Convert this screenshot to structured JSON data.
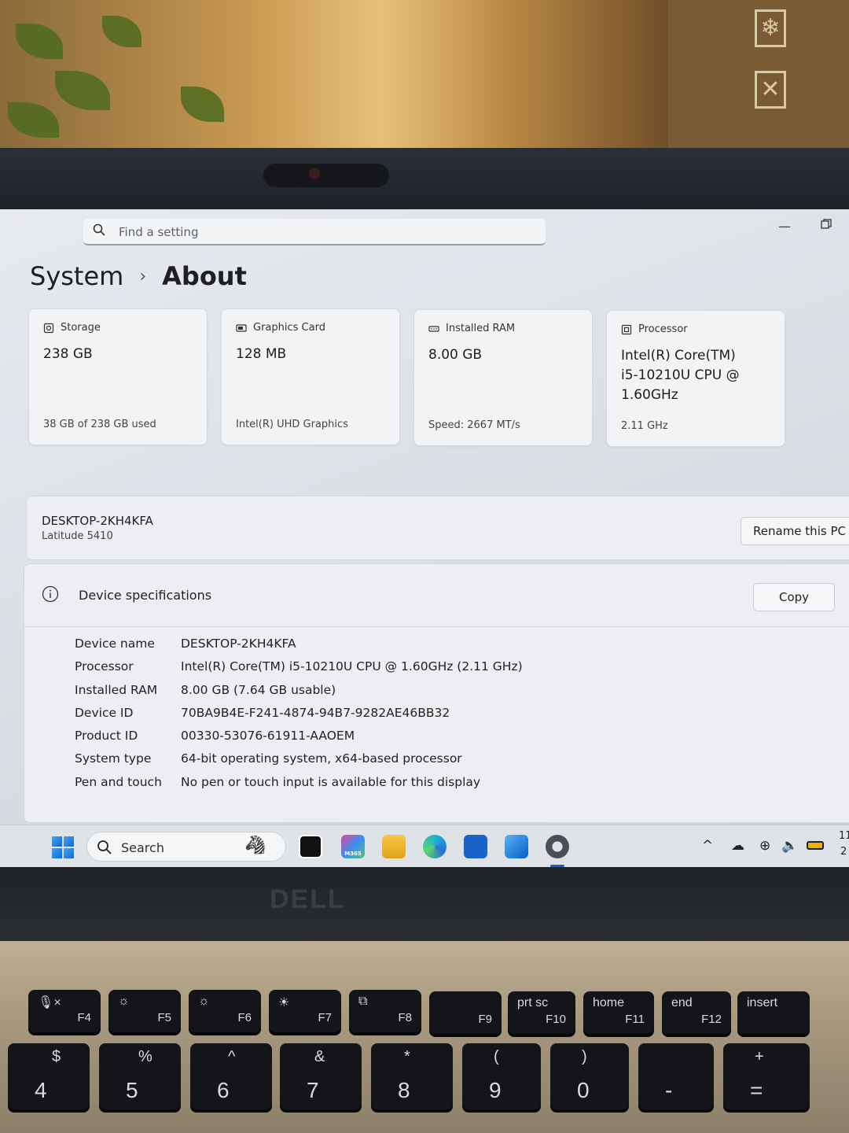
{
  "search": {
    "placeholder": "Find a setting"
  },
  "breadcrumb": {
    "parent": "System",
    "separator": "›",
    "current": "About"
  },
  "cards": [
    {
      "icon": "storage-icon",
      "title": "Storage",
      "value": "238 GB",
      "sub": "38 GB of 238 GB used"
    },
    {
      "icon": "graphics-card-icon",
      "title": "Graphics Card",
      "value": "128 MB",
      "sub": "Intel(R) UHD Graphics"
    },
    {
      "icon": "ram-icon",
      "title": "Installed RAM",
      "value": "8.00 GB",
      "sub": "Speed: 2667 MT/s"
    },
    {
      "icon": "processor-icon",
      "title": "Processor",
      "value": "Intel(R) Core(TM) i5-10210U CPU @ 1.60GHz",
      "sub": "2.11 GHz"
    }
  ],
  "pc": {
    "name": "DESKTOP-2KH4KFA",
    "model": "Latitude 5410",
    "rename_label": "Rename this PC"
  },
  "specs": {
    "title": "Device specifications",
    "copy_label": "Copy",
    "rows": [
      {
        "label": "Device name",
        "value": "DESKTOP-2KH4KFA"
      },
      {
        "label": "Processor",
        "value": "Intel(R) Core(TM) i5-10210U CPU @ 1.60GHz (2.11 GHz)"
      },
      {
        "label": "Installed RAM",
        "value": "8.00 GB (7.64 GB usable)"
      },
      {
        "label": "Device ID",
        "value": "70BA9B4E-F241-4874-94B7-9282AE46BB32"
      },
      {
        "label": "Product ID",
        "value": "00330-53076-61911-AAOEM"
      },
      {
        "label": "System type",
        "value": "64-bit operating system, x64-based processor"
      },
      {
        "label": "Pen and touch",
        "value": "No pen or touch input is available for this display"
      }
    ]
  },
  "taskbar": {
    "search_label": "Search",
    "apps": [
      "task-view-icon",
      "m365-icon",
      "file-explorer-icon",
      "edge-icon",
      "store-icon",
      "outlook-icon",
      "settings-icon"
    ],
    "m365_badge": "M365",
    "clock_partial": "11",
    "clock_partial2": "2"
  },
  "hardware": {
    "brand": "DELL",
    "keys_fn": [
      {
        "top": "🎙×",
        "bot": "F4"
      },
      {
        "top": "☼",
        "bot": "F5"
      },
      {
        "top": "☼",
        "bot": "F6"
      },
      {
        "top": "☀",
        "bot": "F7"
      },
      {
        "top": "⧉",
        "bot": "F8"
      },
      {
        "top": "",
        "bot": "F9"
      },
      {
        "top": "prt sc",
        "bot": "F10"
      },
      {
        "top": "home",
        "bot": "F11"
      },
      {
        "top": "end",
        "bot": "F12"
      },
      {
        "top": "insert",
        "bot": ""
      }
    ],
    "keys_num": [
      {
        "top": "$",
        "big": "4"
      },
      {
        "top": "%",
        "big": "5"
      },
      {
        "top": "^",
        "big": "6"
      },
      {
        "top": "&",
        "big": "7"
      },
      {
        "top": "*",
        "big": "8"
      },
      {
        "top": "(",
        "big": "9"
      },
      {
        "top": ")",
        "big": "0"
      },
      {
        "top": "",
        "big": "-"
      },
      {
        "top": "+",
        "big": "="
      }
    ]
  },
  "colors": {
    "accent": "#0a64c8",
    "panel": "#eceef1",
    "background": "#dfe2e7"
  }
}
